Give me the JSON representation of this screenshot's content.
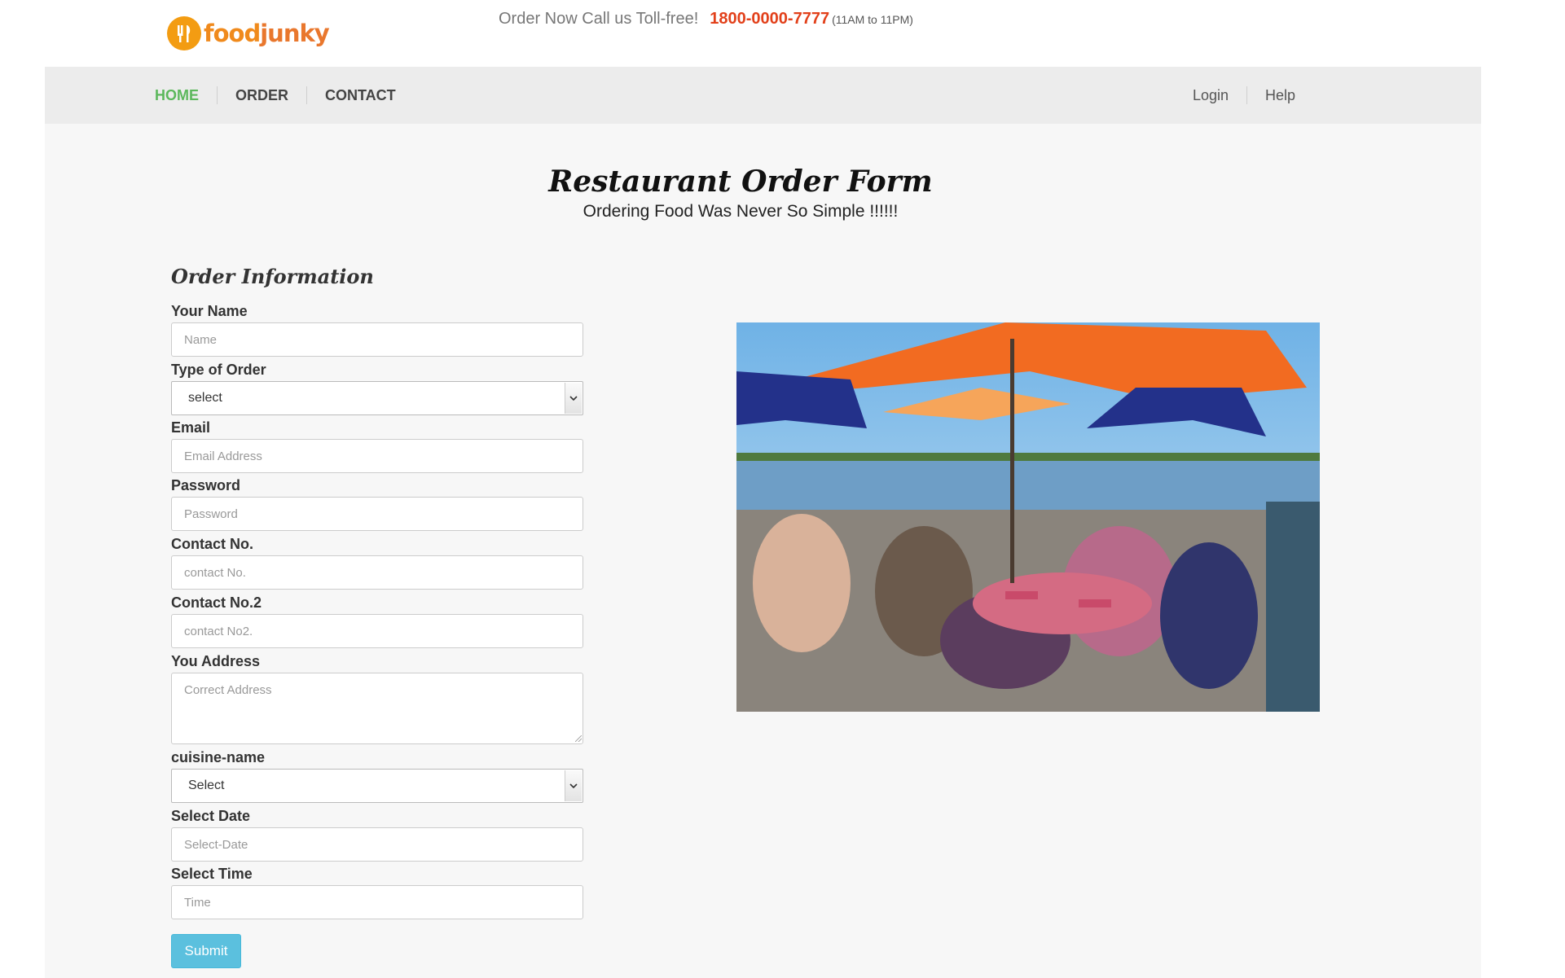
{
  "brand": {
    "logo_text_part1": "food",
    "logo_text_part2": "junky",
    "accent_color": "#f39c12"
  },
  "header": {
    "tollfree_lead": "Order Now Call us Toll-free!",
    "phone": "1800-0000-7777",
    "hours": "(11AM to 11PM)"
  },
  "nav": {
    "left": [
      {
        "label": "HOME",
        "active": true
      },
      {
        "label": "ORDER"
      },
      {
        "label": "CONTACT"
      }
    ],
    "right": [
      {
        "label": "Login"
      },
      {
        "label": "Help"
      }
    ],
    "active_color": "#5cb85c"
  },
  "form": {
    "title": "Restaurant Order Form",
    "subtitle": "Ordering Food Was Never So Simple !!!!!!",
    "section_title": "Order Information",
    "fields": {
      "name": {
        "label": "Your Name",
        "placeholder": "Name",
        "value": ""
      },
      "order_type": {
        "label": "Type of Order",
        "selected": "select"
      },
      "email": {
        "label": "Email",
        "placeholder": "Email Address",
        "value": ""
      },
      "password": {
        "label": "Password",
        "placeholder": "Password",
        "value": ""
      },
      "contact1": {
        "label": "Contact No.",
        "placeholder": "contact No.",
        "value": ""
      },
      "contact2": {
        "label": "Contact No.2",
        "placeholder": "contact No2.",
        "value": ""
      },
      "address": {
        "label": "You Address",
        "placeholder": "Correct Address",
        "value": ""
      },
      "cuisine": {
        "label": "cuisine-name",
        "selected": "Select"
      },
      "date": {
        "label": "Select Date",
        "placeholder": "Select-Date",
        "value": ""
      },
      "time": {
        "label": "Select Time",
        "placeholder": "Time",
        "value": ""
      }
    },
    "submit_label": "Submit",
    "submit_color": "#5bc0de"
  },
  "photo": {
    "icon": "restaurant-patio-photo"
  }
}
